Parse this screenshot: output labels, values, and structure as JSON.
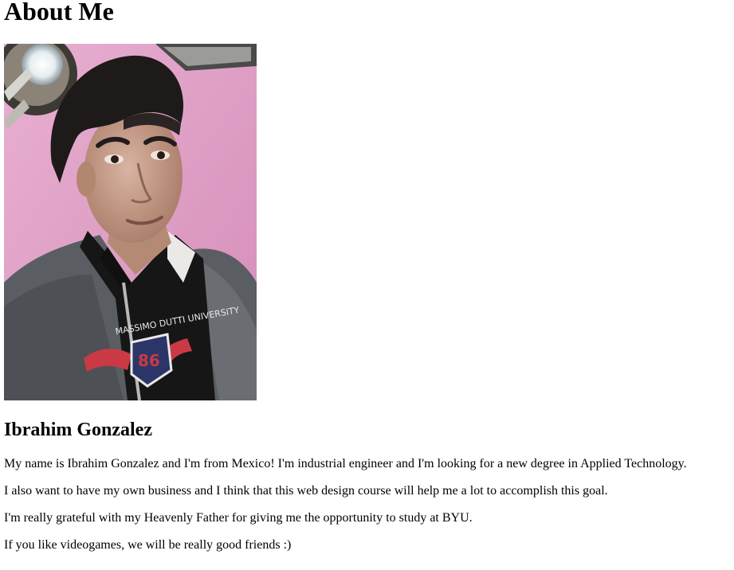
{
  "heading": "About Me",
  "photo": {
    "alt": "Ibrahim Gonzalez",
    "colors": {
      "wall": "#e3a3c8",
      "skin": "#c9a08c",
      "hair": "#1f1a1a",
      "hoodie": "#5b5e63",
      "shirt": "#161616",
      "logo_red": "#c93a45",
      "logo_navy": "#2c3568"
    },
    "logo_text": "MASSIMO DUTTI UNIVERSITY",
    "logo_number": "86"
  },
  "name": "Ibrahim Gonzalez",
  "paragraphs": [
    "My name is Ibrahim Gonzalez and I'm from Mexico! I'm industrial engineer and I'm looking for a new degree in Applied Technology.",
    "I also want to have my own business and I think that this web design course will help me a lot to accomplish this goal.",
    "I'm really grateful with my Heavenly Father for giving me the opportunity to study at BYU.",
    "If you like videogames, we will be really good friends :)"
  ]
}
